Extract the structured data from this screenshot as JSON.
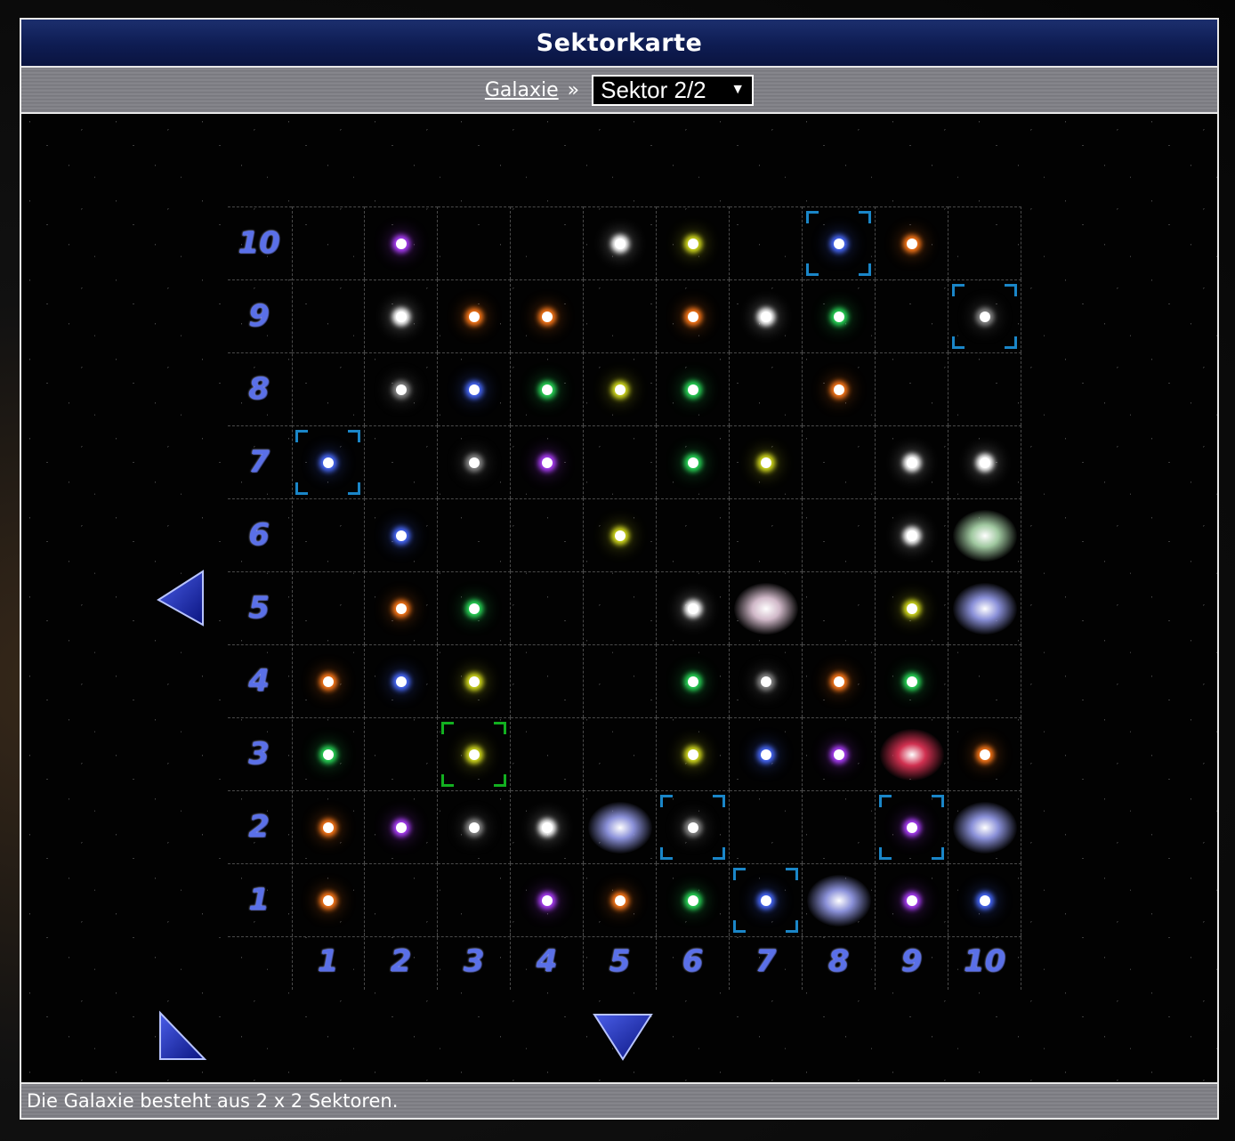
{
  "title": "Sektorkarte",
  "breadcrumb": {
    "galaxy": "Galaxie",
    "separator": "»"
  },
  "sector_select": {
    "value": "Sektor 2/2"
  },
  "footer_text": "Die Galaxie besteht aus 2 x 2 Sektoren.",
  "axis": {
    "x": [
      "1",
      "2",
      "3",
      "4",
      "5",
      "6",
      "7",
      "8",
      "9",
      "10"
    ],
    "y": [
      "10",
      "9",
      "8",
      "7",
      "6",
      "5",
      "4",
      "3",
      "2",
      "1"
    ]
  },
  "colors": {
    "orange": "#ff7a1a",
    "purple": "#b040ff",
    "white": "#ffffff",
    "green": "#2adc5a",
    "yellow": "#d8e020",
    "blue": "#4a6cff",
    "gray": "#8a8a8a",
    "galaxy": "#8a90d8",
    "galaxy_red": "#d03050",
    "nebula": "#d0b8c8",
    "nebula_green": "#a0c8a0"
  },
  "cells": [
    {
      "x": 2,
      "y": 10,
      "t": "purple"
    },
    {
      "x": 5,
      "y": 10,
      "t": "white"
    },
    {
      "x": 6,
      "y": 10,
      "t": "yellow"
    },
    {
      "x": 8,
      "y": 10,
      "t": "blue",
      "sel": "blue"
    },
    {
      "x": 9,
      "y": 10,
      "t": "orange"
    },
    {
      "x": 2,
      "y": 9,
      "t": "white"
    },
    {
      "x": 3,
      "y": 9,
      "t": "orange"
    },
    {
      "x": 4,
      "y": 9,
      "t": "orange"
    },
    {
      "x": 6,
      "y": 9,
      "t": "orange"
    },
    {
      "x": 7,
      "y": 9,
      "t": "white"
    },
    {
      "x": 8,
      "y": 9,
      "t": "green"
    },
    {
      "x": 10,
      "y": 9,
      "t": "gray",
      "sel": "blue"
    },
    {
      "x": 2,
      "y": 8,
      "t": "gray"
    },
    {
      "x": 3,
      "y": 8,
      "t": "blue"
    },
    {
      "x": 4,
      "y": 8,
      "t": "green"
    },
    {
      "x": 5,
      "y": 8,
      "t": "yellow"
    },
    {
      "x": 6,
      "y": 8,
      "t": "green"
    },
    {
      "x": 8,
      "y": 8,
      "t": "orange"
    },
    {
      "x": 1,
      "y": 7,
      "t": "blue",
      "sel": "blue"
    },
    {
      "x": 3,
      "y": 7,
      "t": "gray"
    },
    {
      "x": 4,
      "y": 7,
      "t": "purple"
    },
    {
      "x": 6,
      "y": 7,
      "t": "green"
    },
    {
      "x": 7,
      "y": 7,
      "t": "yellow"
    },
    {
      "x": 9,
      "y": 7,
      "t": "white"
    },
    {
      "x": 10,
      "y": 7,
      "t": "white"
    },
    {
      "x": 2,
      "y": 6,
      "t": "blue"
    },
    {
      "x": 5,
      "y": 6,
      "t": "yellow"
    },
    {
      "x": 9,
      "y": 6,
      "t": "white"
    },
    {
      "x": 10,
      "y": 6,
      "t": "nebula_green"
    },
    {
      "x": 2,
      "y": 5,
      "t": "orange"
    },
    {
      "x": 3,
      "y": 5,
      "t": "green"
    },
    {
      "x": 6,
      "y": 5,
      "t": "white"
    },
    {
      "x": 7,
      "y": 5,
      "t": "nebula"
    },
    {
      "x": 9,
      "y": 5,
      "t": "yellow"
    },
    {
      "x": 10,
      "y": 5,
      "t": "galaxy"
    },
    {
      "x": 1,
      "y": 4,
      "t": "orange"
    },
    {
      "x": 2,
      "y": 4,
      "t": "blue"
    },
    {
      "x": 3,
      "y": 4,
      "t": "yellow"
    },
    {
      "x": 6,
      "y": 4,
      "t": "green"
    },
    {
      "x": 7,
      "y": 4,
      "t": "gray"
    },
    {
      "x": 8,
      "y": 4,
      "t": "orange"
    },
    {
      "x": 9,
      "y": 4,
      "t": "green"
    },
    {
      "x": 1,
      "y": 3,
      "t": "green"
    },
    {
      "x": 3,
      "y": 3,
      "t": "yellow",
      "sel": "green"
    },
    {
      "x": 6,
      "y": 3,
      "t": "yellow"
    },
    {
      "x": 7,
      "y": 3,
      "t": "blue"
    },
    {
      "x": 8,
      "y": 3,
      "t": "purple"
    },
    {
      "x": 9,
      "y": 3,
      "t": "galaxy_red"
    },
    {
      "x": 10,
      "y": 3,
      "t": "orange"
    },
    {
      "x": 1,
      "y": 2,
      "t": "orange"
    },
    {
      "x": 2,
      "y": 2,
      "t": "purple"
    },
    {
      "x": 3,
      "y": 2,
      "t": "gray"
    },
    {
      "x": 4,
      "y": 2,
      "t": "white"
    },
    {
      "x": 5,
      "y": 2,
      "t": "galaxy"
    },
    {
      "x": 6,
      "y": 2,
      "t": "gray",
      "sel": "blue"
    },
    {
      "x": 9,
      "y": 2,
      "t": "purple",
      "sel": "blue"
    },
    {
      "x": 10,
      "y": 2,
      "t": "galaxy"
    },
    {
      "x": 1,
      "y": 1,
      "t": "orange"
    },
    {
      "x": 4,
      "y": 1,
      "t": "purple"
    },
    {
      "x": 5,
      "y": 1,
      "t": "orange"
    },
    {
      "x": 6,
      "y": 1,
      "t": "green"
    },
    {
      "x": 7,
      "y": 1,
      "t": "blue",
      "sel": "blue"
    },
    {
      "x": 8,
      "y": 1,
      "t": "galaxy"
    },
    {
      "x": 9,
      "y": 1,
      "t": "purple"
    },
    {
      "x": 10,
      "y": 1,
      "t": "blue"
    }
  ]
}
